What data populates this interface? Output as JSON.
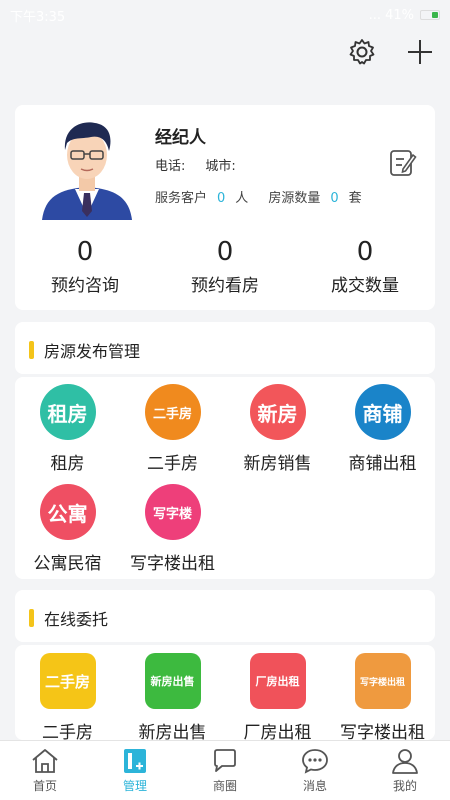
{
  "status_bar": {
    "time": "下午3:35",
    "right_text": "... 41%"
  },
  "profile": {
    "name": "经纪人",
    "phone_label": "电话:",
    "city_label": "城市:",
    "service_label": "服务客户",
    "service_count": "0",
    "service_unit": "人",
    "listing_label": "房源数量",
    "listing_count": "0",
    "listing_unit": "套"
  },
  "stats": [
    {
      "value": "0",
      "label": "预约咨询"
    },
    {
      "value": "0",
      "label": "预约看房"
    },
    {
      "value": "0",
      "label": "成交数量"
    }
  ],
  "section1": {
    "title": "房源发布管理",
    "items": [
      {
        "icon_text": "租房",
        "label": "租房",
        "color": "#2fbfa5"
      },
      {
        "icon_text": "二手房",
        "label": "二手房",
        "color": "#f08a1e"
      },
      {
        "icon_text": "新房",
        "label": "新房销售",
        "color": "#f2565a"
      },
      {
        "icon_text": "商铺",
        "label": "商铺出租",
        "color": "#1a84c9"
      },
      {
        "icon_text": "公寓",
        "label": "公寓民宿",
        "color": "#ef4f63"
      },
      {
        "icon_text": "写字楼",
        "label": "写字楼出租",
        "color": "#ee3f7a"
      }
    ]
  },
  "section2": {
    "title": "在线委托",
    "items": [
      {
        "icon_text": "二手房",
        "label": "二手房",
        "color": "#f5c517"
      },
      {
        "icon_text": "新房出售",
        "label": "新房出售",
        "color": "#3dba3f"
      },
      {
        "icon_text": "厂房出租",
        "label": "厂房出租",
        "color": "#f0525a"
      },
      {
        "icon_text": "写字楼出租",
        "label": "写字楼出租",
        "color": "#ef9a3f"
      }
    ]
  },
  "tabs": [
    {
      "label": "首页",
      "icon": "home-icon",
      "active": false
    },
    {
      "label": "管理",
      "icon": "manage-icon",
      "active": true
    },
    {
      "label": "商圈",
      "icon": "chat-square-icon",
      "active": false
    },
    {
      "label": "消息",
      "icon": "message-icon",
      "active": false
    },
    {
      "label": "我的",
      "icon": "user-icon",
      "active": false
    }
  ],
  "colors": {
    "accent": "#2cb4d9",
    "section_bar": "#f4c41a"
  }
}
